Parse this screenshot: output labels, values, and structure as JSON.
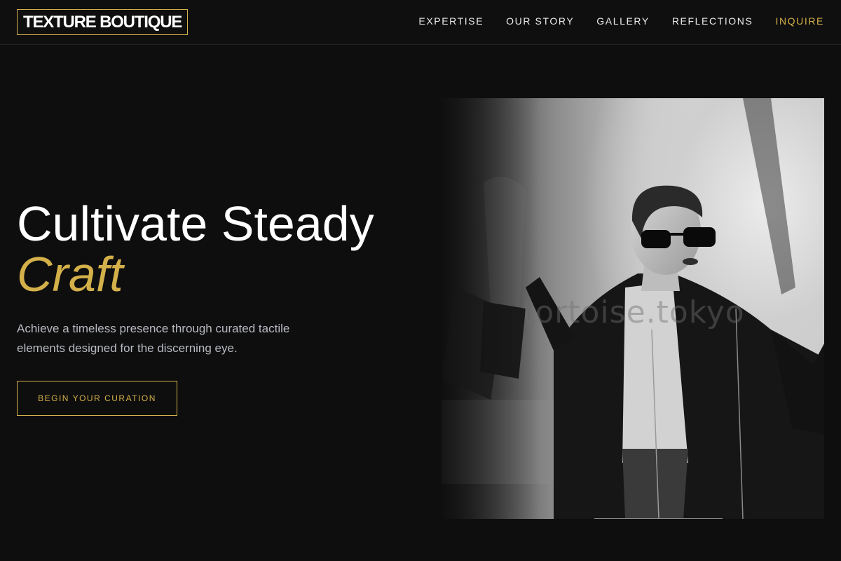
{
  "brand": {
    "logo_text": "TEXTURE BOUTIQUE"
  },
  "nav": {
    "items": [
      {
        "label": "EXPERTISE",
        "accent": false
      },
      {
        "label": "OUR STORY",
        "accent": false
      },
      {
        "label": "GALLERY",
        "accent": false
      },
      {
        "label": "REFLECTIONS",
        "accent": false
      },
      {
        "label": "INQUIRE",
        "accent": true
      }
    ]
  },
  "hero": {
    "title_line1": "Cultivate Steady",
    "title_line2": "Craft",
    "subtitle": "Achieve a timeless presence through curated tactile elements designed for the discerning eye.",
    "cta_label": "BEGIN YOUR CURATION",
    "image_watermark": "tortoise.tokyo"
  },
  "colors": {
    "background": "#0e0e0e",
    "accent_gold": "#d4b04a",
    "text_primary": "#ffffff",
    "text_muted": "#b8bac2"
  }
}
